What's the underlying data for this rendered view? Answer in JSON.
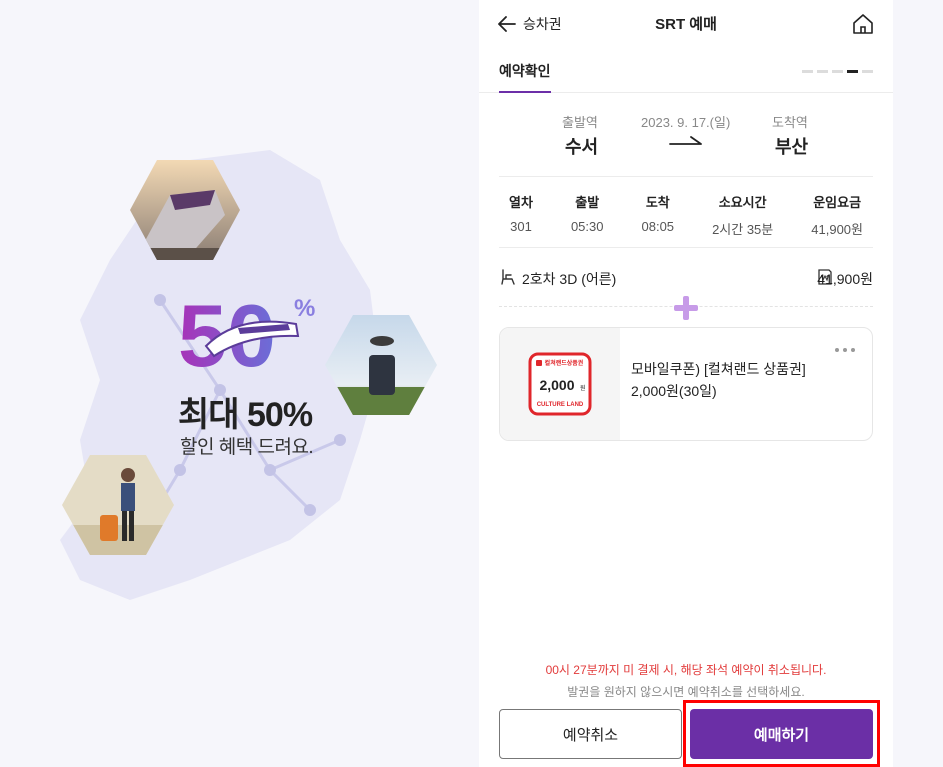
{
  "promo": {
    "big_number": "50",
    "percent": "%",
    "headline": "최대 50%",
    "subline": "할인 혜택 드려요."
  },
  "header": {
    "back_label": "승차권",
    "title": "SRT 예매"
  },
  "tabs": {
    "active_label": "예약확인",
    "steps_total": 5,
    "current_step": 4
  },
  "route": {
    "departure_label": "출발역",
    "departure_station": "수서",
    "date": "2023. 9. 17.(일)",
    "arrival_label": "도착역",
    "arrival_station": "부산"
  },
  "info_table": [
    {
      "header": "열차",
      "value": "301"
    },
    {
      "header": "출발",
      "value": "05:30"
    },
    {
      "header": "도착",
      "value": "08:05"
    },
    {
      "header": "소요시간",
      "value": "2시간 35분"
    },
    {
      "header": "운임요금",
      "value": "41,900원"
    }
  ],
  "seat": {
    "description": "2호차 3D (어른)",
    "price": "41,900원"
  },
  "coupon": {
    "image_brand": "컬쳐랜드상품권",
    "image_amount": "2,000",
    "image_unit": "원",
    "image_footer": "CULTURE LAND",
    "title": "모바일쿠폰) [컬쳐랜드 상품권] 2,000원(30일)"
  },
  "notice": {
    "warning": "00시 27분까지 미 결제 시, 해당 좌석 예약이 취소됩니다.",
    "guide": "발권을 원하지 않으시면 예약취소를 선택하세요."
  },
  "buttons": {
    "cancel_label": "예약취소",
    "buy_label": "예매하기"
  },
  "colors": {
    "brand_purple": "#6b2fa6",
    "warning_red": "#e23b3b",
    "highlight_red": "#ff0000"
  }
}
